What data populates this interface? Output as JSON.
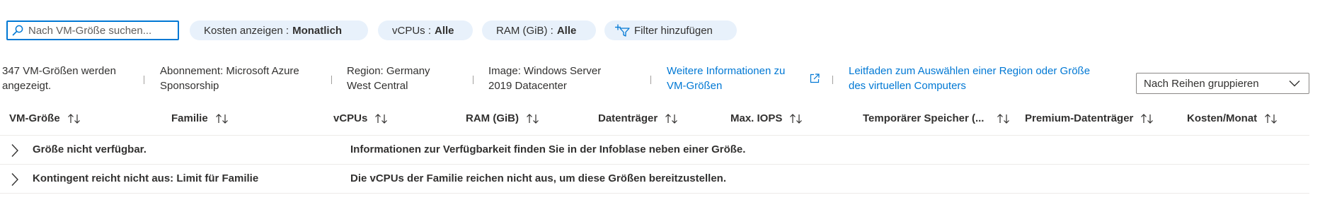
{
  "toolbar": {
    "search_placeholder": "Nach VM-Größe suchen...",
    "filters": [
      {
        "label": "Kosten anzeigen :",
        "value": "Monatlich"
      },
      {
        "label": "vCPUs :",
        "value": "Alle"
      },
      {
        "label": "RAM (GiB) :",
        "value": "Alle"
      }
    ],
    "add_filter_label": "Filter hinzufügen"
  },
  "info_bar": {
    "count_line1": "347 VM-Größen werden",
    "count_line2": "angezeigt.",
    "subscription_line1": "Abonnement: Microsoft Azure",
    "subscription_line2": "Sponsorship",
    "region_line1": "Region: Germany",
    "region_line2": "West Central",
    "image_line1": "Image: Windows Server",
    "image_line2": "2019 Datacenter",
    "more_info_line1": "Weitere Informationen zu",
    "more_info_line2": "VM-Größen",
    "guide_line1": "Leitfaden zum Auswählen einer Region oder Größe",
    "guide_line2": "des virtuellen Computers",
    "group_by": "Nach Reihen gruppieren"
  },
  "table": {
    "columns": [
      "VM-Größe",
      "Familie",
      "vCPUs",
      "RAM (GiB)",
      "Datenträger",
      "Max. IOPS",
      "Temporärer Speicher (...",
      "Premium-Datenträger",
      "Kosten/Monat"
    ],
    "groups": [
      {
        "title": "Größe nicht verfügbar.",
        "message": "Informationen zur Verfügbarkeit finden Sie in der Infoblase neben einer Größe."
      },
      {
        "title": "Kontingent reicht nicht aus: Limit für Familie",
        "message": "Die vCPUs der Familie reichen nicht aus, um diese Größen bereitzustellen."
      }
    ]
  },
  "colors": {
    "accent": "#0078d4",
    "pill_bg": "#e8f1fb",
    "text": "#323130",
    "divider": "#edebe9"
  }
}
